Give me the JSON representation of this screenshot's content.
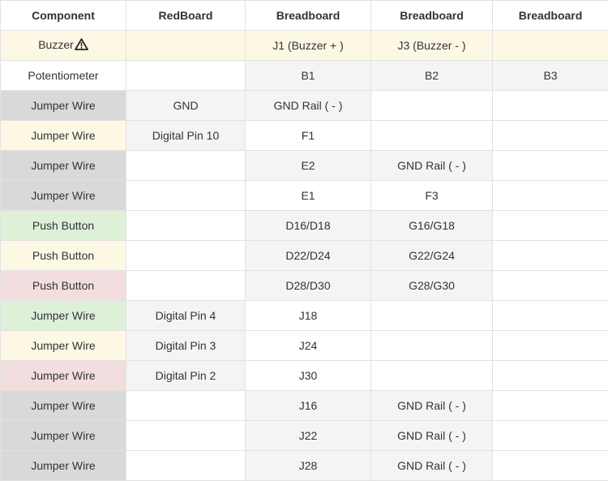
{
  "headers": [
    "Component",
    "RedBoard",
    "Breadboard",
    "Breadboard",
    "Breadboard"
  ],
  "rows": [
    {
      "cells": [
        "Buzzer",
        "",
        "J1 (Buzzer + )",
        "J3 (Buzzer - )",
        ""
      ],
      "warning_icon": "warning-triangle-icon"
    },
    {
      "cells": [
        "Potentiometer",
        "",
        "B1",
        "B2",
        "B3"
      ]
    },
    {
      "cells": [
        "Jumper Wire",
        "GND",
        "GND Rail ( - )",
        "",
        ""
      ]
    },
    {
      "cells": [
        "Jumper Wire",
        "Digital Pin 10",
        "F1",
        "",
        ""
      ]
    },
    {
      "cells": [
        "Jumper Wire",
        "",
        "E2",
        "GND Rail ( - )",
        ""
      ]
    },
    {
      "cells": [
        "Jumper Wire",
        "",
        "E1",
        "F3",
        ""
      ]
    },
    {
      "cells": [
        "Push Button",
        "",
        "D16/D18",
        "G16/G18",
        ""
      ]
    },
    {
      "cells": [
        "Push Button",
        "",
        "D22/D24",
        "G22/G24",
        ""
      ]
    },
    {
      "cells": [
        "Push Button",
        "",
        "D28/D30",
        "G28/G30",
        ""
      ]
    },
    {
      "cells": [
        "Jumper Wire",
        "Digital Pin 4",
        "J18",
        "",
        ""
      ]
    },
    {
      "cells": [
        "Jumper Wire",
        "Digital Pin 3",
        "J24",
        "",
        ""
      ]
    },
    {
      "cells": [
        "Jumper Wire",
        "Digital Pin 2",
        "J30",
        "",
        ""
      ]
    },
    {
      "cells": [
        "Jumper Wire",
        "",
        "J16",
        "GND Rail ( - )",
        ""
      ]
    },
    {
      "cells": [
        "Jumper Wire",
        "",
        "J22",
        "GND Rail ( - )",
        ""
      ]
    },
    {
      "cells": [
        "Jumper Wire",
        "",
        "J28",
        "GND Rail ( - )",
        ""
      ]
    }
  ],
  "colors": {
    "yellow": "#fcf8e3",
    "green": "#dff0d8",
    "red": "#f2dede",
    "dark_gray": "#d9d9d9",
    "light_gray": "#f4f4f4",
    "border": "#e2e2e2"
  }
}
